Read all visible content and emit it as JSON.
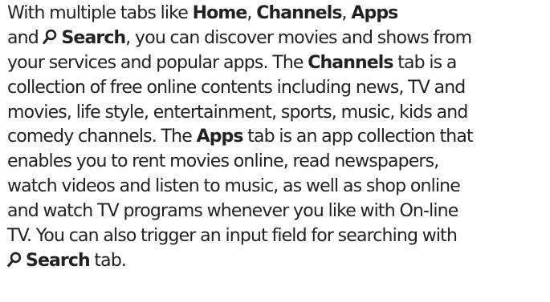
{
  "paragraph": {
    "l1": {
      "a": "With multiple tabs like ",
      "b": "Home",
      "c": ", ",
      "d": "Channels",
      "e": ", ",
      "f": "Apps"
    },
    "l2": {
      "a": "and ",
      "icon": "search-icon",
      "b": "Search",
      "c": ", you can discover movies and shows from"
    },
    "l3": {
      "a": "your services and popular apps. The ",
      "b": "Channels",
      "c": " tab is a"
    },
    "l4": {
      "a": "collection of free online contents including news, TV and"
    },
    "l5": {
      "a": "movies, life style, entertainment, sports, music, kids and"
    },
    "l6": {
      "a": "comedy channels. The ",
      "b": "Apps",
      "c": " tab is an app collection that"
    },
    "l7": {
      "a": "enables you to rent movies online, read newspapers,"
    },
    "l8": {
      "a": "watch videos and listen to music, as well as shop online"
    },
    "l9": {
      "a": "and watch TV programs whenever you like with On-line"
    },
    "l10": {
      "a": "TV. You can also trigger an input field for searching with"
    },
    "l11": {
      "icon": "search-icon",
      "b": "Search",
      "c": " tab."
    }
  }
}
